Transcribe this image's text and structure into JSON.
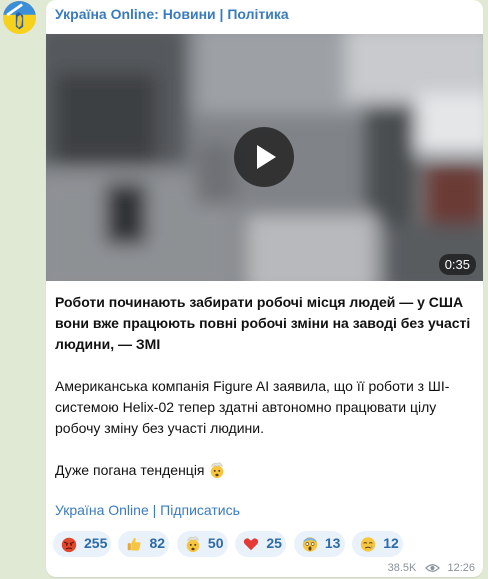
{
  "channel": {
    "name": "Україна Online: Новини | Політика",
    "avatar_icon": "ukraine-flag-avatar-icon"
  },
  "video": {
    "duration": "0:35",
    "play_icon": "play-icon"
  },
  "post": {
    "headline": "Роботи починають забирати робочі місця людей — у США вони вже працюють повні робочі зміни на заводі без участі людини, — ЗМІ",
    "paragraph1": "Американська компанія Figure AI заявила, що її роботи з ШІ-системою Helix-02 тепер здатні автономно працювати цілу робочу зміну без участі людини.",
    "paragraph2": "Дуже погана тенденція",
    "paragraph2_emoji": "exploding-head-emoji"
  },
  "footer": {
    "channel_link": "Україна Online",
    "separator": "|",
    "subscribe_link": "Підписатись"
  },
  "reactions": [
    {
      "icon": "enraged-face-emoji",
      "count": "255"
    },
    {
      "icon": "thumbs-up-emoji",
      "count": "82"
    },
    {
      "icon": "exploding-head-emoji",
      "count": "50"
    },
    {
      "icon": "red-heart-emoji",
      "count": "25"
    },
    {
      "icon": "screaming-face-emoji",
      "count": "13"
    },
    {
      "icon": "crying-face-emoji",
      "count": "12"
    }
  ],
  "meta": {
    "views": "38.5K",
    "time": "12:26",
    "views_icon": "eye-icon"
  },
  "colors": {
    "chat_background": "#dfe9d3",
    "accent": "#3a7bbf",
    "reaction_background": "#e9f2fb"
  }
}
